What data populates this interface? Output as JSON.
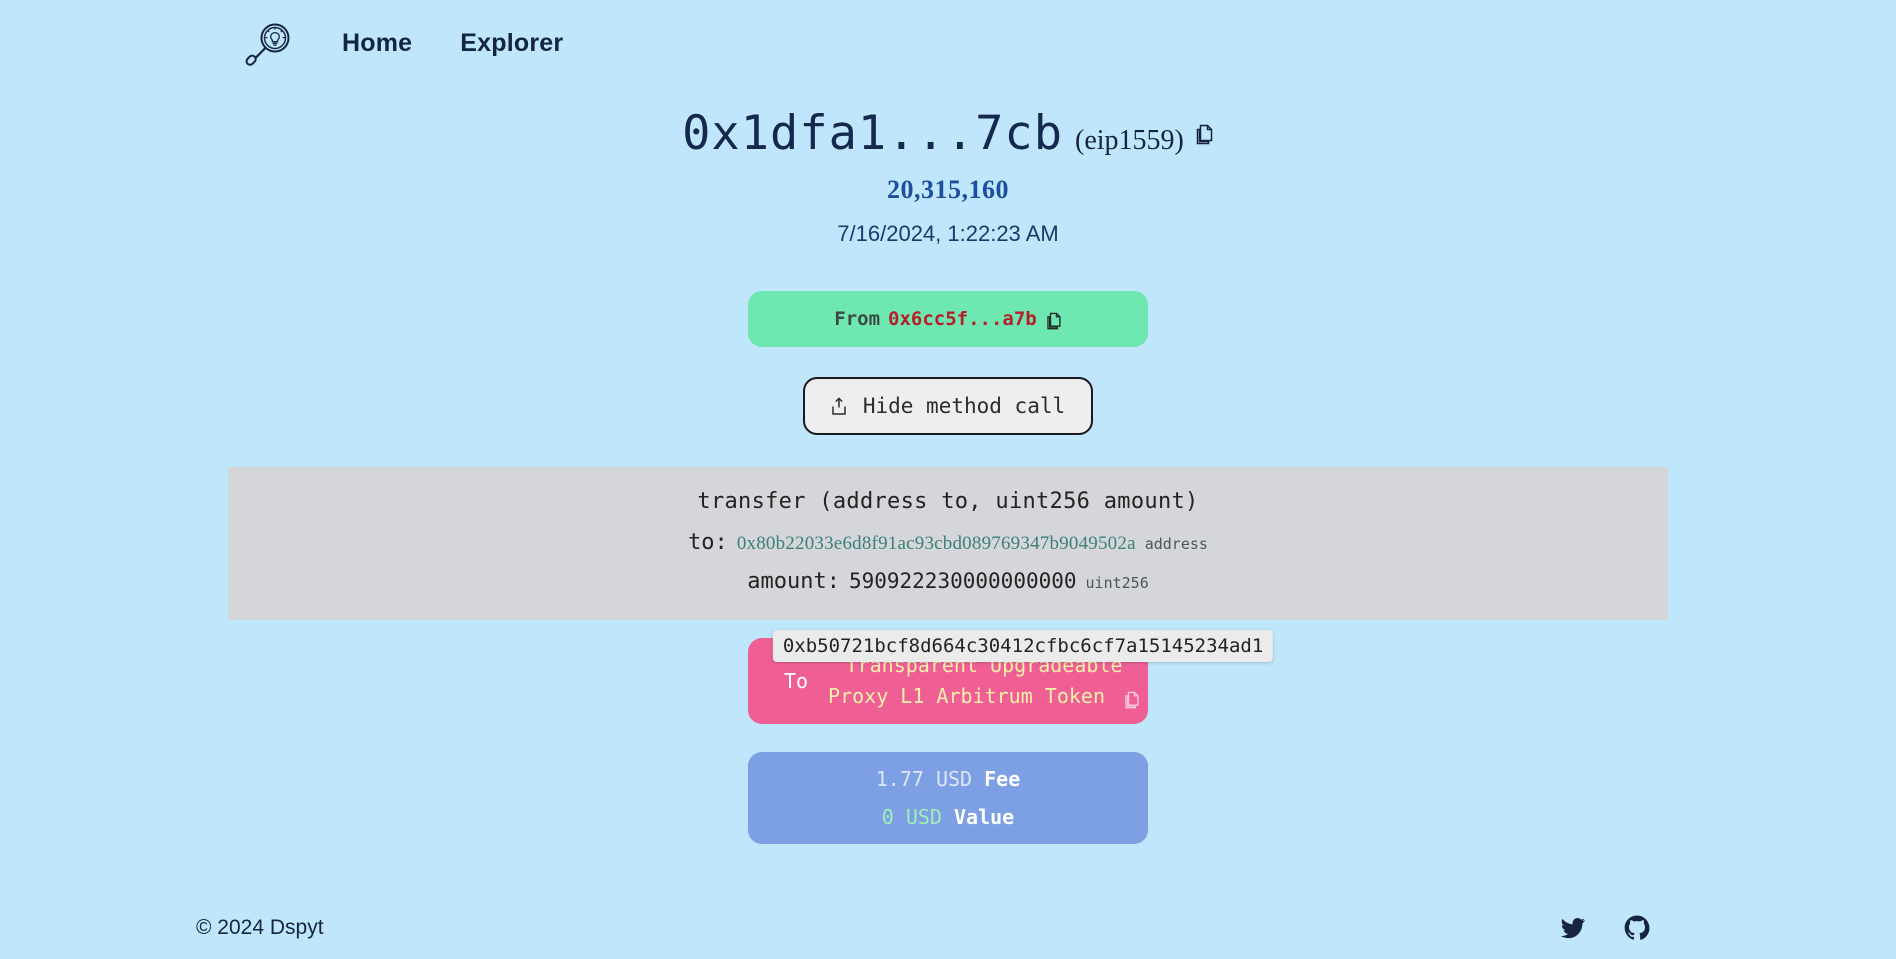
{
  "nav": {
    "logo_icon": "magnifier-lightbulb-logo",
    "links": [
      {
        "label": "Home"
      },
      {
        "label": "Explorer"
      }
    ]
  },
  "transaction": {
    "hash_short": "0x1dfa1...7cb",
    "type_label": "(eip1559)",
    "copy_icon": "copy-icon",
    "block_number": "20,315,160",
    "timestamp": "7/16/2024, 1:22:23 AM"
  },
  "from": {
    "label": "From",
    "address_short": "0x6cc5f...a7b",
    "copy_icon": "copy-icon",
    "bg_color": "#6ee7b0"
  },
  "method_button": {
    "label": "Hide method call",
    "icon": "share-upload-icon"
  },
  "method_call": {
    "signature": "transfer (address to, uint256 amount)",
    "params": [
      {
        "key": "to:",
        "value": "0x80b22033e6d8f91ac93cbd089769347b9049502a",
        "type": "address"
      },
      {
        "key": "amount:",
        "value": "590922230000000000",
        "type": "uint256"
      }
    ]
  },
  "to": {
    "tooltip_address": "0xb50721bcf8d664c30412cfbc6cf7a15145234ad1",
    "label": "To",
    "contract_name_line1": "Transparent Upgradeable",
    "contract_name_line2": "Proxy L1 Arbitrum Token",
    "copy_icon": "copy-icon",
    "bg_color": "#ef5f96"
  },
  "fee": {
    "fee_amount": "1.77 USD",
    "fee_word": "Fee",
    "value_amount": "0 USD",
    "value_word": "Value",
    "bg_color": "#7d9fe3"
  },
  "footer": {
    "copyright": "© 2024 Dspyt",
    "social": [
      {
        "icon": "twitter-icon"
      },
      {
        "icon": "github-icon"
      }
    ]
  },
  "theme": {
    "page_bg": "#bfe6fb",
    "text_primary": "#16243f",
    "accent_block": "#1d4f9e"
  }
}
